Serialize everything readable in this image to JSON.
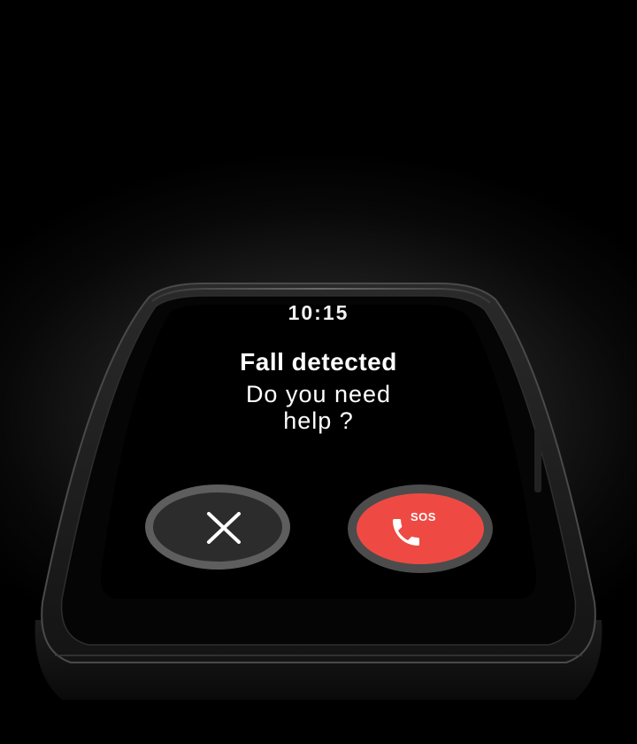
{
  "screen": {
    "time": "10:15",
    "title": "Fall detected",
    "question_line1": "Do you need",
    "question_line2": "help ?"
  },
  "actions": {
    "dismiss_icon": "close-icon",
    "sos_icon": "phone-icon",
    "sos_label": "SOS"
  },
  "colors": {
    "sos_red": "#ee4a43",
    "dismiss_fill": "#2c2c2c",
    "dismiss_ring": "#5e5e5e"
  }
}
